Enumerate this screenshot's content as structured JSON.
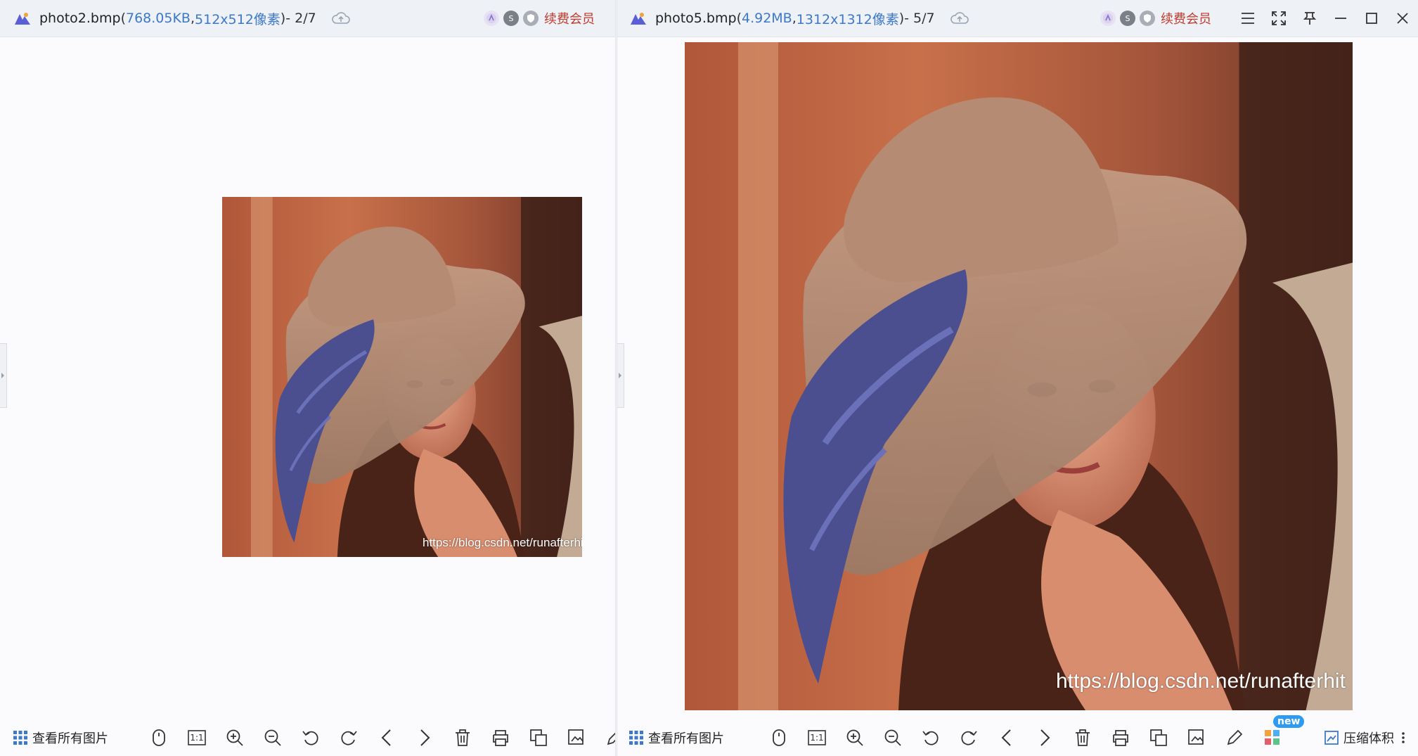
{
  "left": {
    "title": {
      "filename": "photo2.bmp",
      "open": " (",
      "filesize": "768.05KB",
      "sep": " , ",
      "dims": "512x512像素",
      "close": ")",
      "index": " - 2/7"
    },
    "vip_label": "续费会员",
    "watermark": "https://blog.csdn.net/runafterhit",
    "all_pictures": "查看所有图片",
    "tools": [
      "mouse-icon",
      "actual-size-icon",
      "zoom-in-icon",
      "zoom-out-icon",
      "rotate-left-icon",
      "rotate-right-icon",
      "previous-icon",
      "next-icon",
      "delete-icon",
      "print-icon",
      "convert-icon",
      "save-as-icon",
      "edit-icon"
    ],
    "actual_size_label": "1:1"
  },
  "right": {
    "title": {
      "filename": "photo5.bmp",
      "open": " (",
      "filesize": "4.92MB",
      "sep": " , ",
      "dims": "1312x1312像素",
      "close": ")",
      "index": " - 5/7"
    },
    "vip_label": "续费会员",
    "watermark": "https://blog.csdn.net/runafterhit",
    "all_pictures": "查看所有图片",
    "new_badge": "new",
    "compress_label": "压缩体积",
    "actual_size_label": "1:1",
    "window_controls": [
      "menu-icon",
      "fullscreen-icon",
      "pin-icon",
      "minimize-icon",
      "maximize-icon",
      "close-icon"
    ]
  },
  "colors": {
    "accent_blue": "#3d79c6",
    "vip_red": "#c0392b",
    "badge_blue": "#2e9bf0"
  }
}
